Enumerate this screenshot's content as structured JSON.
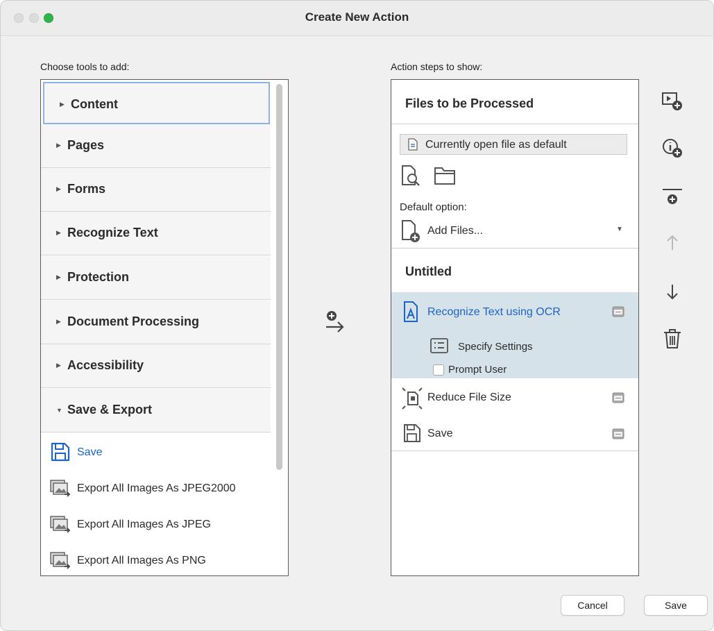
{
  "window": {
    "title": "Create New Action"
  },
  "left": {
    "heading": "Choose tools to add:",
    "categories": [
      {
        "label": "Content",
        "expanded": false,
        "selected": true
      },
      {
        "label": "Pages",
        "expanded": false
      },
      {
        "label": "Forms",
        "expanded": false
      },
      {
        "label": "Recognize Text",
        "expanded": false
      },
      {
        "label": "Protection",
        "expanded": false
      },
      {
        "label": "Document Processing",
        "expanded": false
      },
      {
        "label": "Accessibility",
        "expanded": false
      },
      {
        "label": "Save & Export",
        "expanded": true
      }
    ],
    "tools": [
      {
        "label": "Save",
        "icon": "save-icon"
      },
      {
        "label": "Export All Images As JPEG2000",
        "icon": "export-images-icon"
      },
      {
        "label": "Export All Images As JPEG",
        "icon": "export-images-icon"
      },
      {
        "label": "Export All Images As PNG",
        "icon": "export-images-icon"
      }
    ]
  },
  "right": {
    "heading": "Action steps to show:",
    "files_header": "Files to be Processed",
    "current_file": "Currently open file as default",
    "default_option_label": "Default option:",
    "default_option_value": "Add Files...",
    "group_title": "Untitled",
    "steps": [
      {
        "label": "Recognize Text using OCR",
        "selected": true
      },
      {
        "label": "Reduce File Size"
      },
      {
        "label": "Save"
      }
    ],
    "specify_settings": "Specify Settings",
    "prompt_user": "Prompt User",
    "prompt_user_checked": false
  },
  "buttons": {
    "cancel": "Cancel",
    "save": "Save"
  },
  "colors": {
    "accent": "#1b63c6",
    "selection": "#d6e2ea",
    "traffic_green": "#2fb64a"
  }
}
